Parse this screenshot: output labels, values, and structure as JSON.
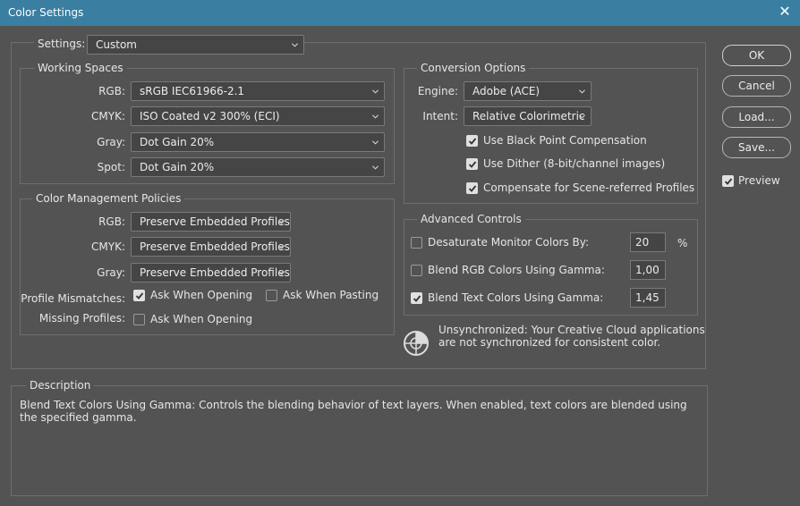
{
  "window": {
    "title": "Color Settings",
    "close_glyph": "✕"
  },
  "settings": {
    "label": "Settings:",
    "value": "Custom"
  },
  "working_spaces": {
    "legend": "Working Spaces",
    "rgb_label": "RGB:",
    "rgb_value": "sRGB IEC61966-2.1",
    "cmyk_label": "CMYK:",
    "cmyk_value": "ISO Coated v2 300% (ECI)",
    "gray_label": "Gray:",
    "gray_value": "Dot Gain 20%",
    "spot_label": "Spot:",
    "spot_value": "Dot Gain 20%"
  },
  "policies": {
    "legend": "Color Management Policies",
    "rgb_label": "RGB:",
    "rgb_value": "Preserve Embedded Profiles",
    "cmyk_label": "CMYK:",
    "cmyk_value": "Preserve Embedded Profiles",
    "gray_label": "Gray:",
    "gray_value": "Preserve Embedded Profiles",
    "mismatch_label": "Profile Mismatches:",
    "mismatch_opening": {
      "label": "Ask When Opening",
      "checked": true
    },
    "mismatch_pasting": {
      "label": "Ask When Pasting",
      "checked": false
    },
    "missing_label": "Missing Profiles:",
    "missing_opening": {
      "label": "Ask When Opening",
      "checked": false
    }
  },
  "conversion": {
    "legend": "Conversion Options",
    "engine_label": "Engine:",
    "engine_value": "Adobe (ACE)",
    "intent_label": "Intent:",
    "intent_value": "Relative Colorimetric",
    "black_point": {
      "label": "Use Black Point Compensation",
      "checked": true
    },
    "dither": {
      "label": "Use Dither (8-bit/channel images)",
      "checked": true
    },
    "scene": {
      "label": "Compensate for Scene-referred Profiles",
      "checked": true
    }
  },
  "advanced": {
    "legend": "Advanced Controls",
    "desaturate": {
      "label": "Desaturate Monitor Colors By:",
      "checked": false,
      "value": "20",
      "unit": "%"
    },
    "blend_rgb": {
      "label": "Blend RGB Colors Using Gamma:",
      "checked": false,
      "value": "1,00"
    },
    "blend_text": {
      "label": "Blend Text Colors Using Gamma:",
      "checked": true,
      "value": "1,45"
    }
  },
  "sync": {
    "icon": "unsynchronized-icon",
    "line1": "Unsynchronized: Your Creative Cloud applications",
    "line2": "are not synchronized for consistent color."
  },
  "buttons": {
    "ok": "OK",
    "cancel": "Cancel",
    "load": "Load...",
    "save": "Save..."
  },
  "preview": {
    "label": "Preview",
    "checked": true
  },
  "description": {
    "legend": "Description",
    "text": "Blend Text Colors Using Gamma:  Controls the blending behavior of text layers.  When enabled, text colors are blended using the specified gamma."
  },
  "colors": {
    "titlebar": "#3a7fa1",
    "background": "#535353"
  }
}
